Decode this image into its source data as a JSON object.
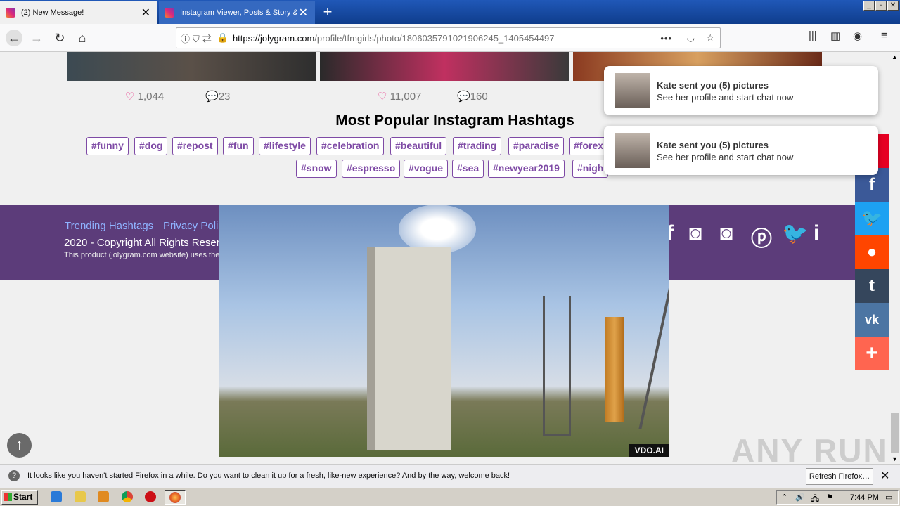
{
  "browser": {
    "tabs": [
      {
        "title": "(2) New Message!",
        "active": false
      },
      {
        "title": "Instagram Viewer, Posts & Story &",
        "active": true
      }
    ],
    "url_host": "https://jolygram.com",
    "url_path": "/profile/tfmgirls/photo/1806035791021906245_1405454497",
    "window_buttons": [
      "_",
      "▫",
      "✕"
    ]
  },
  "posts": [
    {
      "likes": "1,044",
      "comments": "23"
    },
    {
      "likes": "11,007",
      "comments": "160"
    }
  ],
  "hashtags": {
    "title": "Most Popular Instagram Hashtags",
    "row1": [
      "#funny",
      "#dog",
      "#repost",
      "#fun",
      "#lifestyle",
      "#celebration",
      "#beautiful",
      "#trading",
      "#paradise",
      "#forex"
    ],
    "row2": [
      "#snow",
      "#espresso",
      "#vogue",
      "#sea",
      "#newyear2019",
      "#nigh"
    ]
  },
  "footer": {
    "links": [
      "Trending Hashtags",
      "Privacy Polic"
    ],
    "copyright": "2020 - Copyright All Rights Reserv",
    "small": "This product (jolygram.com website) uses the"
  },
  "video": {
    "badge": "VDO.AI"
  },
  "notifications": [
    {
      "title": "Kate sent you (5) pictures",
      "text": "See her profile and start chat now"
    },
    {
      "title": "Kate sent you (5) pictures",
      "text": "See her profile and start chat now"
    }
  ],
  "share_bar": [
    {
      "icon": "pinterest-icon",
      "glyph": "P",
      "color": "#e60023"
    },
    {
      "icon": "facebook-icon",
      "glyph": "f",
      "color": "#3b5998"
    },
    {
      "icon": "twitter-icon",
      "glyph": "🐦",
      "color": "#1da1f2"
    },
    {
      "icon": "reddit-icon",
      "glyph": "●",
      "color": "#ff4500"
    },
    {
      "icon": "tumblr-icon",
      "glyph": "t",
      "color": "#35465c"
    },
    {
      "icon": "vk-icon",
      "glyph": "vk",
      "color": "#4c75a3"
    },
    {
      "icon": "more-icon",
      "glyph": "+",
      "color": "#ff6550"
    }
  ],
  "watermark": "ANY RUN",
  "infobar": {
    "message": "It looks like you haven't started Firefox in a while. Do you want to clean it up for a fresh, like-new experience? And by the way, welcome back!",
    "button": "Refresh Firefox…"
  },
  "taskbar": {
    "start": "Start",
    "clock": "7:44 PM"
  }
}
